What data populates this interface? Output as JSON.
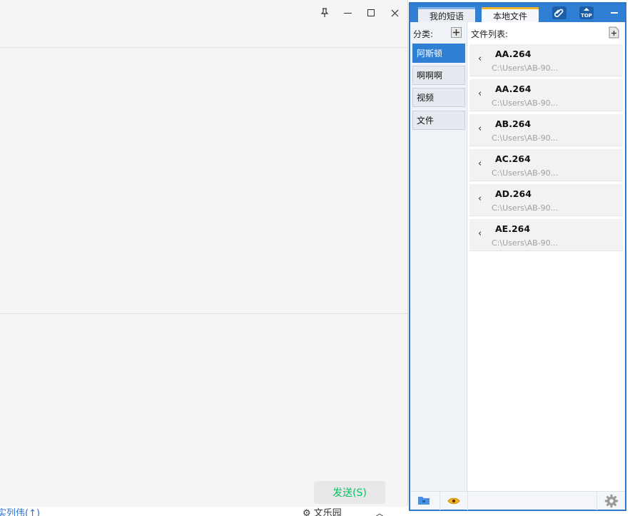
{
  "chat": {
    "send_button_label": "发送(S)",
    "behind_link_text": "实列伟(↑)",
    "behind_right_text": "⚙ 文乐园"
  },
  "panel": {
    "tabs": [
      {
        "label": "我的短语"
      },
      {
        "label": "本地文件"
      }
    ],
    "active_tab": "本地文件",
    "accent_color": "#2f7fd4",
    "category_header": "分类:",
    "file_header": "文件列表:",
    "categories": [
      {
        "label": "阿斯顿"
      },
      {
        "label": "啊啊啊"
      },
      {
        "label": "视频"
      },
      {
        "label": "文件"
      }
    ],
    "active_category": "阿斯顿",
    "files": [
      {
        "name": "AA.264",
        "path": "C:\\Users\\AB-90..."
      },
      {
        "name": "AA.264",
        "path": "C:\\Users\\AB-90..."
      },
      {
        "name": "AB.264",
        "path": "C:\\Users\\AB-90..."
      },
      {
        "name": "AC.264",
        "path": "C:\\Users\\AB-90..."
      },
      {
        "name": "AD.264",
        "path": "C:\\Users\\AB-90..."
      },
      {
        "name": "AE.264",
        "path": "C:\\Users\\AB-90..."
      }
    ],
    "icons": {
      "attach": "paperclip-icon",
      "top": "top-pin-icon",
      "folder": "folder-icon",
      "eye": "eye-icon",
      "settings": "gear-icon"
    }
  }
}
